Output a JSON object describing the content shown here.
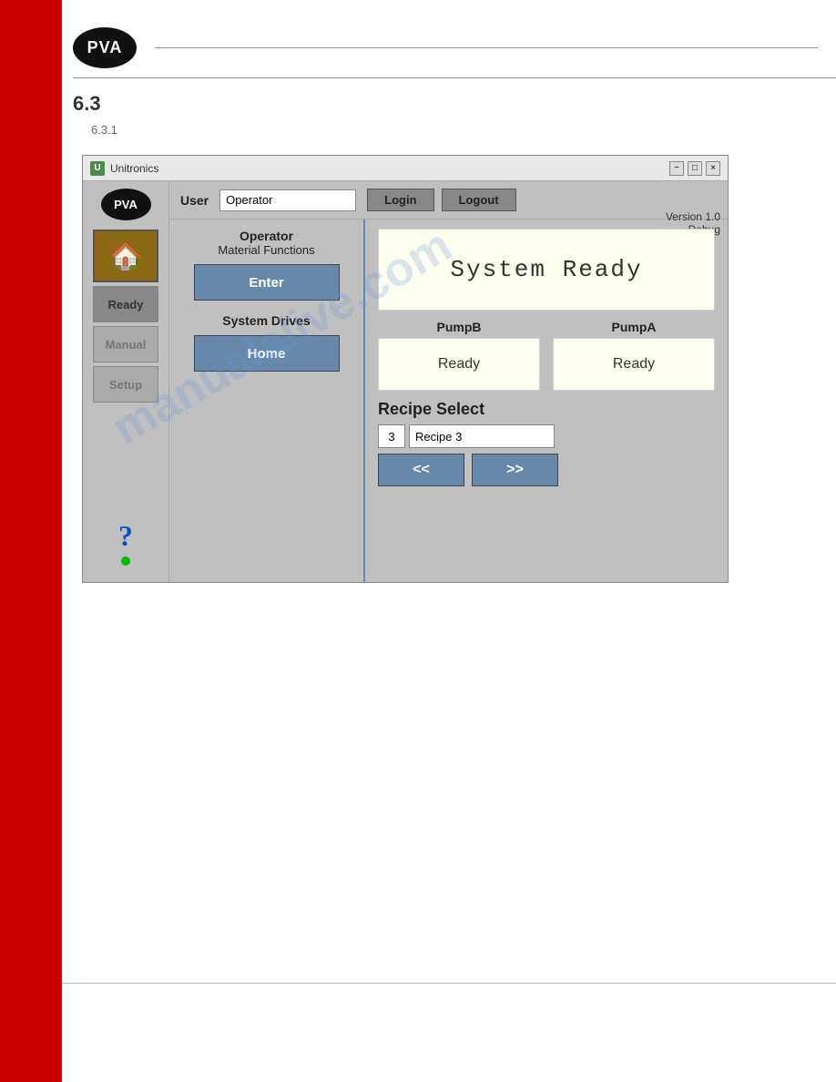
{
  "page": {
    "section": "6.3",
    "subsection": "6.3.1"
  },
  "header": {
    "logo_text": "PVA"
  },
  "window": {
    "title": "Unitronics",
    "version": "Version 1.0",
    "debug": "Debug",
    "controls": {
      "minimize": "−",
      "maximize": "□",
      "close": "×"
    }
  },
  "sidebar": {
    "logo_text": "PVA",
    "home_icon": "🏠",
    "nav": [
      {
        "label": "Ready",
        "state": "active"
      },
      {
        "label": "Manual",
        "state": "inactive"
      },
      {
        "label": "Setup",
        "state": "inactive"
      }
    ],
    "help_icon": "?",
    "green_dot": true
  },
  "user_section": {
    "label": "User",
    "input_value": "Operator",
    "login_label": "Login",
    "logout_label": "Logout"
  },
  "operator_section": {
    "title_line1": "Operator",
    "title_line2": "Material Functions",
    "enter_label": "Enter"
  },
  "system_drives": {
    "title": "System Drives",
    "home_label": "Home"
  },
  "system_status": {
    "text": "System Ready"
  },
  "pumps": {
    "pump_b": {
      "label": "PumpB",
      "status": "Ready"
    },
    "pump_a": {
      "label": "PumpA",
      "status": "Ready"
    }
  },
  "recipe": {
    "title": "Recipe Select",
    "number": "3",
    "name": "Recipe 3",
    "prev_label": "<<",
    "next_label": ">>"
  },
  "watermark": "manualalive.com"
}
